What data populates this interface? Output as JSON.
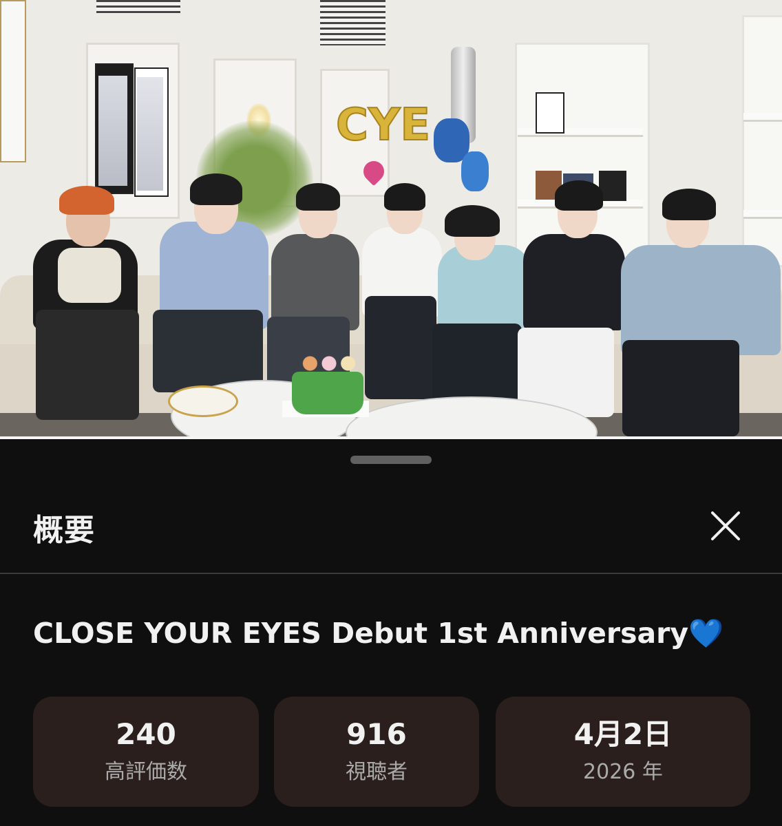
{
  "panel": {
    "heading": "概要",
    "close_icon": "close-icon"
  },
  "video": {
    "title": "CLOSE YOUR EYES Debut 1st Anniversary",
    "title_emoji": "💙",
    "balloon_text": "CYE"
  },
  "stats": [
    {
      "value": "240",
      "label": "高評価数"
    },
    {
      "value": "916",
      "label": "視聴者"
    },
    {
      "value": "4月2日",
      "label": "2026 年"
    }
  ],
  "colors": {
    "background": "#0f0f0f",
    "stat_card": "#2a1f1c",
    "heart": "#2f7ff0"
  }
}
